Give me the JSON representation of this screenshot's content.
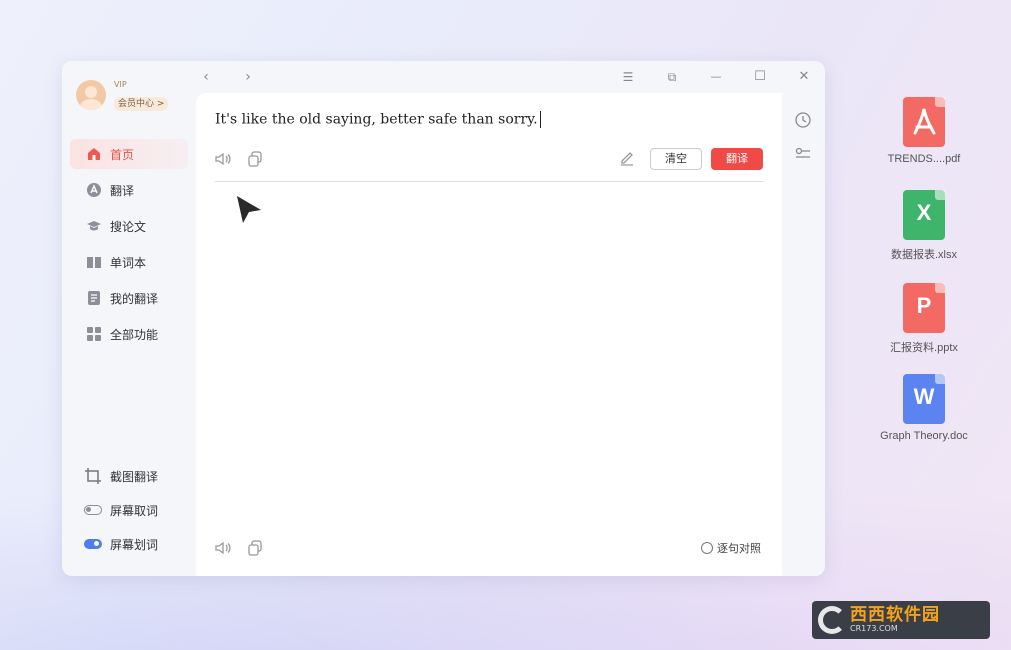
{
  "user": {
    "vip": "VIP",
    "member_center": "会员中心 >"
  },
  "nav": [
    {
      "label": "首页",
      "active": true,
      "icon": "home-icon"
    },
    {
      "label": "翻译",
      "active": false,
      "icon": "translate-icon"
    },
    {
      "label": "搜论文",
      "active": false,
      "icon": "graduation-cap-icon"
    },
    {
      "label": "单词本",
      "active": false,
      "icon": "book-icon"
    },
    {
      "label": "我的翻译",
      "active": false,
      "icon": "document-icon"
    },
    {
      "label": "全部功能",
      "active": false,
      "icon": "grid-icon"
    }
  ],
  "tools": [
    {
      "label": "截图翻译",
      "icon": "crop-icon"
    },
    {
      "label": "屏幕取词",
      "icon": "toggle-off-icon"
    },
    {
      "label": "屏幕划词",
      "icon": "toggle-on-icon"
    }
  ],
  "topbar": {
    "back": "‹",
    "forward": "›",
    "menu": "☰",
    "restore": "⧉",
    "minimize": "—",
    "maximize": "☐",
    "close": "✕"
  },
  "editor": {
    "source_text": "It's like the old saying, better safe than sorry.",
    "clear_label": "清空",
    "translate_label": "翻译",
    "sentence_compare": "逐句对照"
  },
  "files": [
    {
      "name": "TRENDS....pdf",
      "color": "#f26a63",
      "glyph": "⅄",
      "icon": "pdf-icon"
    },
    {
      "name": "数据报表.xlsx",
      "color": "#3fb56b",
      "glyph": "X",
      "icon": "excel-icon"
    },
    {
      "name": "汇报资料.pptx",
      "color": "#f26a63",
      "glyph": "P",
      "icon": "powerpoint-icon"
    },
    {
      "name": "Graph Theory.doc",
      "color": "#5b84f0",
      "glyph": "W",
      "icon": "word-icon"
    }
  ],
  "watermark": {
    "main": "西西软件园",
    "sub": "CR173.COM"
  }
}
